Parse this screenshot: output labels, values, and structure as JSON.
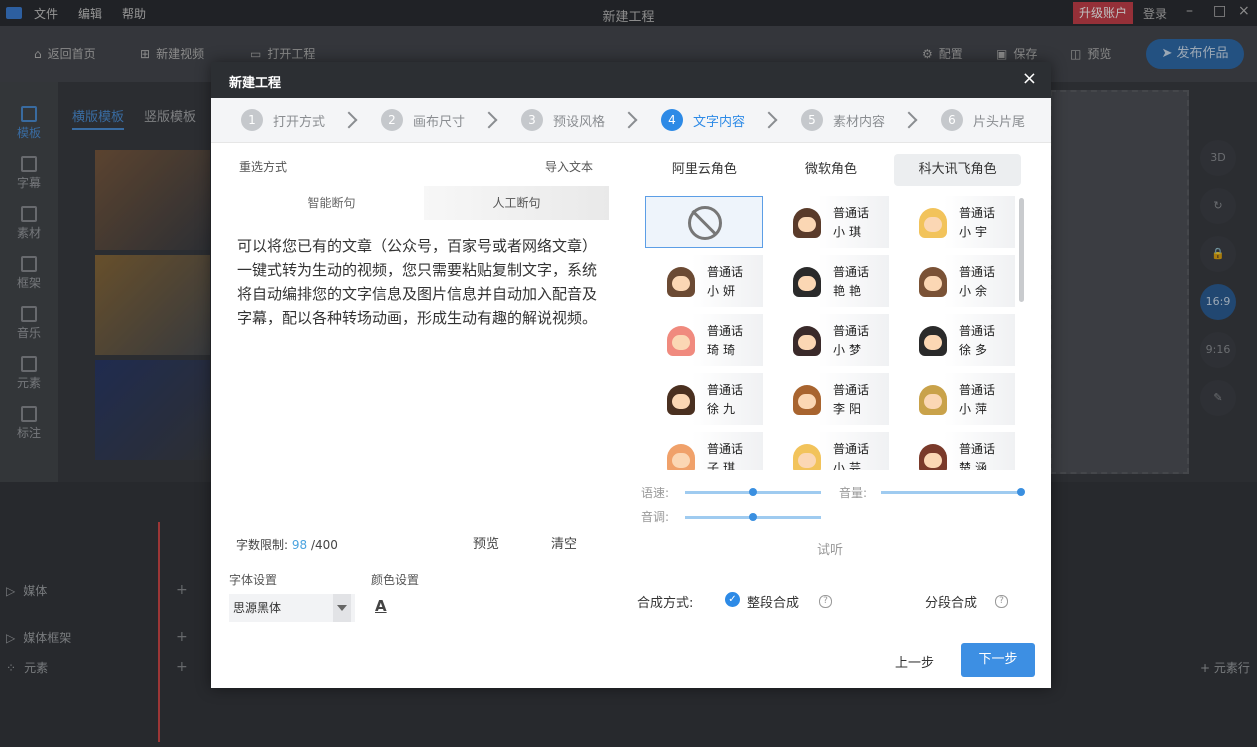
{
  "app": {
    "menu": [
      "文件",
      "编辑",
      "帮助"
    ],
    "window_title": "新建工程",
    "upgrade": "升级账户",
    "login": "登录",
    "toolbar": {
      "home": "返回首页",
      "new_video": "新建视频",
      "open_project": "打开工程",
      "config": "配置",
      "save": "保存",
      "preview": "预览",
      "publish": "发布作品"
    },
    "left_nav": [
      "模板",
      "字幕",
      "素材",
      "框架",
      "音乐",
      "元素",
      "标注"
    ],
    "library_tabs": [
      "横版模板",
      "竖版模板"
    ],
    "right_tools": [
      "3D",
      "16:9",
      "9:16"
    ],
    "timeline": {
      "rows": [
        "媒体",
        "媒体框架",
        "元素"
      ],
      "add_element_row": "+ 元素行"
    }
  },
  "dialog": {
    "title": "新建工程",
    "close": "×",
    "steps": [
      {
        "num": "1",
        "label": "打开方式"
      },
      {
        "num": "2",
        "label": "画布尺寸"
      },
      {
        "num": "3",
        "label": "预设风格"
      },
      {
        "num": "4",
        "label": "文字内容"
      },
      {
        "num": "5",
        "label": "素材内容"
      },
      {
        "num": "6",
        "label": "片头片尾"
      }
    ],
    "current_step": 4,
    "left": {
      "reselect": "重选方式",
      "import_text": "导入文本",
      "split_tabs": [
        "智能断句",
        "人工断句"
      ],
      "article": "可以将您已有的文章（公众号，百家号或者网络文章）一键式转为生动的视频，您只需要粘贴复制文字，系统将自动编排您的文字信息及图片信息并自动加入配音及字幕，配以各种转场动画，形成生动有趣的解说视频。",
      "limit_label": "字数限制:",
      "count": "98",
      "limit_max": "/400",
      "preview": "预览",
      "clear": "清空",
      "font_label": "字体设置",
      "color_label": "颜色设置",
      "font_value": "思源黑体",
      "color_glyph": "A"
    },
    "right": {
      "role_tabs": [
        "阿里云角色",
        "微软角色",
        "科大讯飞角色"
      ],
      "roles": [
        {
          "lang": "普通话",
          "name": "小琪",
          "hair": "#5a3b2a"
        },
        {
          "lang": "普通话",
          "name": "小宇",
          "hair": "#f2c35b"
        },
        {
          "lang": "普通话",
          "name": "小妍",
          "hair": "#6b4a33"
        },
        {
          "lang": "普通话",
          "name": "艳艳",
          "hair": "#2a2a2a"
        },
        {
          "lang": "普通话",
          "name": "小余",
          "hair": "#7a5236"
        },
        {
          "lang": "普通话",
          "name": "琦琦",
          "hair": "#f08a7e"
        },
        {
          "lang": "普通话",
          "name": "小梦",
          "hair": "#3a2a2a"
        },
        {
          "lang": "普通话",
          "name": "徐多",
          "hair": "#2a2a2a"
        },
        {
          "lang": "普通话",
          "name": "徐九",
          "hair": "#4a3020"
        },
        {
          "lang": "普通话",
          "name": "李阳",
          "hair": "#a8642f"
        },
        {
          "lang": "普通话",
          "name": "小萍",
          "hair": "#c9a24a"
        },
        {
          "lang": "普通话",
          "name": "子琪",
          "hair": "#f0a16a"
        },
        {
          "lang": "普通话",
          "name": "小芸",
          "hair": "#f2c35b"
        },
        {
          "lang": "普通话",
          "name": "楚涵",
          "hair": "#7a3a2a"
        }
      ],
      "speed_label": "语速:",
      "volume_label": "音量:",
      "pitch_label": "音调:",
      "speed": 0.5,
      "volume": 1.0,
      "pitch": 0.5,
      "listen": "试听",
      "compose_label": "合成方式:",
      "compose_whole": "整段合成",
      "compose_segment": "分段合成",
      "compose_selected": "整段合成"
    },
    "prev": "上一步",
    "next": "下一步"
  },
  "colors": {
    "accent": "#2d8ae6",
    "dialog_header": "#2c2f33",
    "upgrade": "#c7404b"
  }
}
